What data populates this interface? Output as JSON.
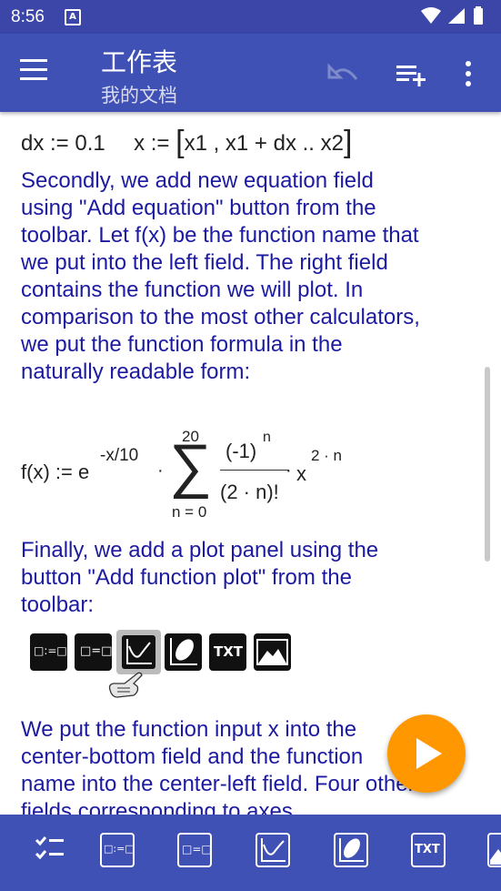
{
  "status_bar": {
    "time": "8:56",
    "notification_badge": "A"
  },
  "app_bar": {
    "title": "工作表",
    "subtitle": "我的文档"
  },
  "content": {
    "top_line": {
      "dx": "dx := 0.1",
      "x_def": "x := ",
      "range": "x1 , x1 + dx .. x2"
    },
    "paragraph1": "Secondly, we add new equation field using \"Add equation\" button from the toolbar. Let f(x) be the function name that we put into the left field. The right field contains the function we will plot. In comparison to the most other calculators, we put the function formula in the naturally readable form:",
    "formula": {
      "lhs": "f(x) := e",
      "exponent": "-x/10",
      "dot": "·",
      "sum_upper": "20",
      "sum_lower": "n = 0",
      "numerator": "(-1)",
      "numerator_exp": "n",
      "denominator": "(2 · n)!",
      "x_term": "x",
      "x_exp": "2 · n"
    },
    "paragraph2": "Finally, we add a plot panel using the button \"Add function plot\" from the toolbar:",
    "toolbar_labels": {
      "equation_a": "□:=□",
      "equation_b": "□=□",
      "text": "TXT"
    },
    "paragraph3": "We put the function input x into the center-bottom field and the function name into the center-left field. Four other fields corresponding to axes"
  },
  "bottom_bar": {
    "equation_a": "□:=□",
    "equation_b": "□=□",
    "text": "TXT"
  },
  "colors": {
    "primary": "#3f51b5",
    "status": "#3b46a8",
    "accent": "#ff9800",
    "text_blue": "#1c1aa0"
  }
}
